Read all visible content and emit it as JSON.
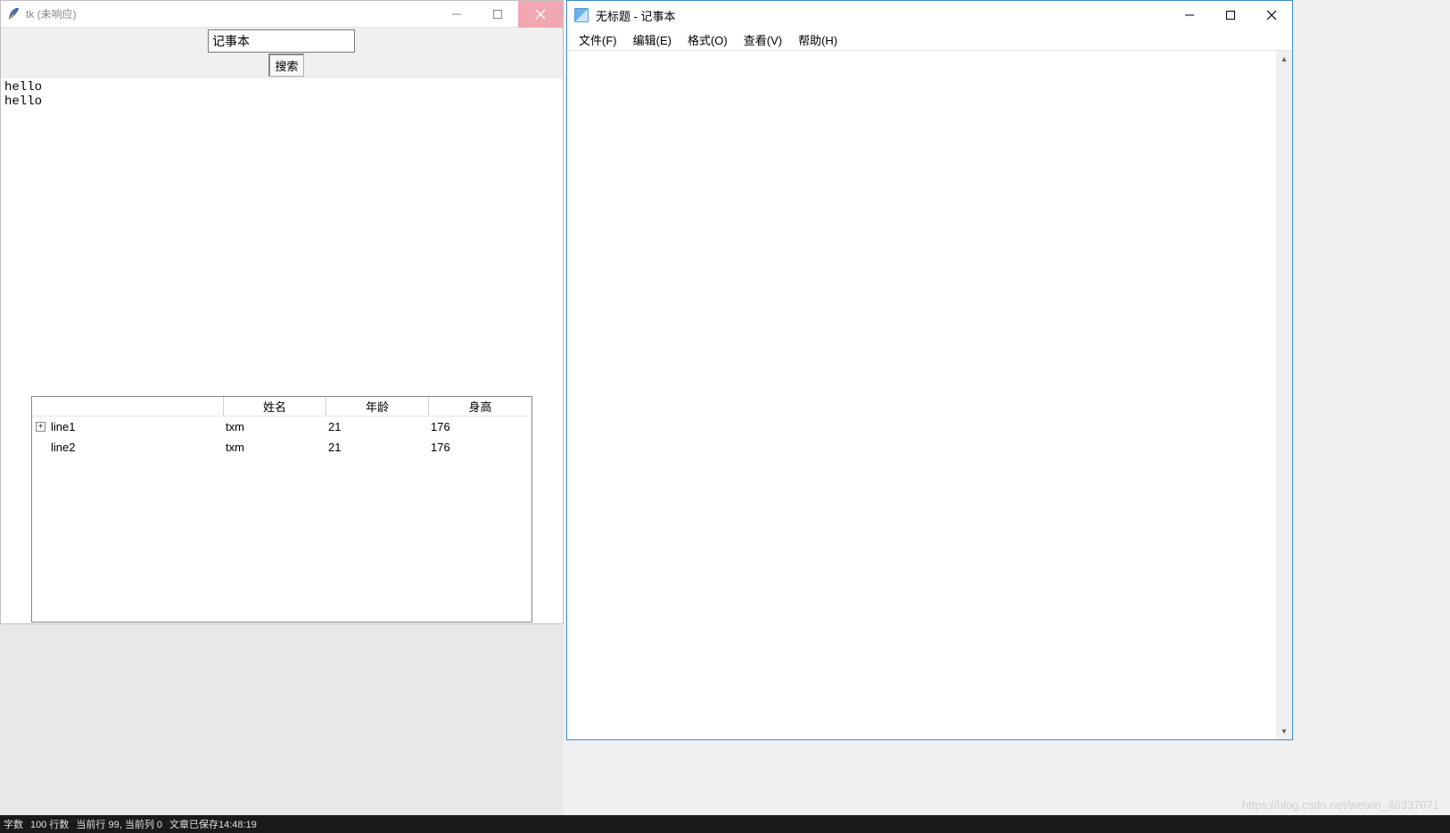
{
  "tk": {
    "title": "tk (未响应)",
    "search_value": "记事本",
    "search_btn": "搜索",
    "text_content": "hello\nhello",
    "tree": {
      "headers": {
        "col0": "",
        "col1": "姓名",
        "col2": "年龄",
        "col3": "身高"
      },
      "rows": [
        {
          "expandable": true,
          "label": "line1",
          "name": "txm",
          "age": "21",
          "height": "176"
        },
        {
          "expandable": false,
          "label": "line2",
          "name": "txm",
          "age": "21",
          "height": "176"
        }
      ]
    }
  },
  "notepad": {
    "title": "无标题 - 记事本",
    "menus": {
      "file": "文件(F)",
      "edit": "编辑(E)",
      "format": "格式(O)",
      "view": "查看(V)",
      "help": "帮助(H)"
    },
    "content": ""
  },
  "statusbar": {
    "seg1": "字数",
    "seg2": "100 行数",
    "seg3": "当前行 99, 当前列 0",
    "seg4": "文章已保存14:48:19"
  },
  "watermark": "https://blog.csdn.net/weixin_46337071"
}
